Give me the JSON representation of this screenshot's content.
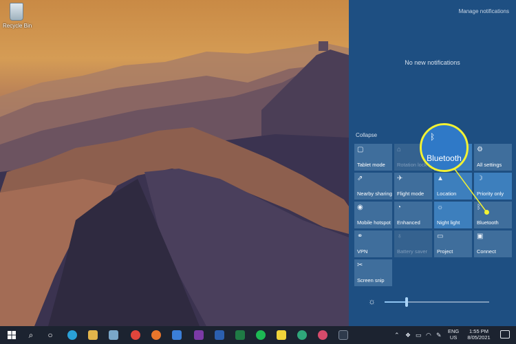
{
  "desktop": {
    "recycle_bin_label": "Recycle Bin"
  },
  "action_center": {
    "manage_notifications": "Manage notifications",
    "no_notifications": "No new notifications",
    "collapse": "Collapse",
    "tiles": [
      {
        "label": "Tablet mode",
        "icon": "tablet-icon",
        "state": "normal"
      },
      {
        "label": "Rotation lock",
        "icon": "rotation-icon",
        "state": "disabled"
      },
      {
        "label": "",
        "icon": "",
        "state": "on"
      },
      {
        "label": "All settings",
        "icon": "gear-icon",
        "state": "normal"
      },
      {
        "label": "Nearby sharing",
        "icon": "share-icon",
        "state": "normal"
      },
      {
        "label": "Flight mode",
        "icon": "airplane-icon",
        "state": "normal"
      },
      {
        "label": "Location",
        "icon": "location-icon",
        "state": "on"
      },
      {
        "label": "Priority only",
        "icon": "moon-icon",
        "state": "on"
      },
      {
        "label": "Mobile hotspot",
        "icon": "hotspot-icon",
        "state": "normal"
      },
      {
        "label": "Enhanced",
        "icon": "battery-saver-icon",
        "state": "normal"
      },
      {
        "label": "Night light",
        "icon": "sun-icon",
        "state": "on"
      },
      {
        "label": "Bluetooth",
        "icon": "bluetooth-icon",
        "state": "normal"
      },
      {
        "label": "VPN",
        "icon": "vpn-icon",
        "state": "normal"
      },
      {
        "label": "Battery saver",
        "icon": "battery-icon",
        "state": "disabled"
      },
      {
        "label": "Project",
        "icon": "project-icon",
        "state": "normal"
      },
      {
        "label": "Connect",
        "icon": "connect-icon",
        "state": "normal"
      },
      {
        "label": "Screen snip",
        "icon": "snip-icon",
        "state": "normal"
      }
    ],
    "brightness_level": 0.21
  },
  "callout": {
    "label": "Bluetooth",
    "highlight_color": "#f2f233"
  },
  "taskbar": {
    "language_line1": "ENG",
    "language_line2": "US",
    "time": "1:55 PM",
    "date": "8/05/2021"
  }
}
